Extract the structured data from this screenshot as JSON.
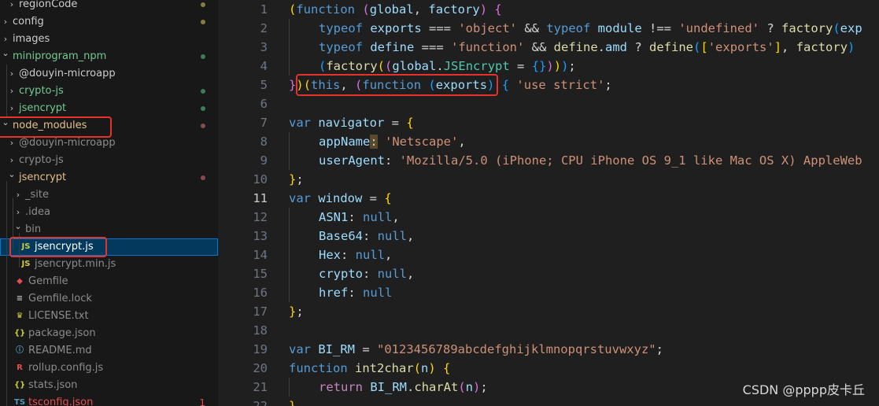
{
  "explorer": {
    "items": [
      {
        "label": "regionCode",
        "indent": 1,
        "type": "folder-closed",
        "color": "#cccccc",
        "status": "dot",
        "status_color": "#8a7a45"
      },
      {
        "label": "config",
        "indent": 0,
        "type": "folder-closed",
        "color": "#cccccc",
        "status": "dot",
        "status_color": "#8a7a45"
      },
      {
        "label": "images",
        "indent": 0,
        "type": "folder-closed",
        "color": "#cccccc"
      },
      {
        "label": "miniprogram_npm",
        "indent": 0,
        "type": "folder-open",
        "color": "#73c991",
        "status": "dot",
        "status_color": "#3f7d57"
      },
      {
        "label": "@douyin-microapp",
        "indent": 1,
        "type": "folder-closed",
        "color": "#cccccc"
      },
      {
        "label": "crypto-js",
        "indent": 1,
        "type": "folder-closed",
        "color": "#73c991",
        "status": "dot",
        "status_color": "#3f7d57"
      },
      {
        "label": "jsencrypt",
        "indent": 1,
        "type": "folder-closed",
        "color": "#73c991",
        "status": "dot",
        "status_color": "#3f7d57"
      },
      {
        "label": "node_modules",
        "indent": 0,
        "type": "folder-open",
        "color": "#e2c08d",
        "status": "dot",
        "status_color": "#8a4a4a"
      },
      {
        "label": "@douyin-microapp",
        "indent": 1,
        "type": "folder-closed",
        "color": "#8c8c8c"
      },
      {
        "label": "crypto-js",
        "indent": 1,
        "type": "folder-closed",
        "color": "#8c8c8c"
      },
      {
        "label": "jsencrypt",
        "indent": 1,
        "type": "folder-open",
        "color": "#e2c08d",
        "status": "dot",
        "status_color": "#8a4a4a"
      },
      {
        "label": "_site",
        "indent": 2,
        "type": "folder-closed",
        "color": "#8c8c8c"
      },
      {
        "label": ".idea",
        "indent": 2,
        "type": "folder-closed",
        "color": "#8c8c8c"
      },
      {
        "label": "bin",
        "indent": 2,
        "type": "folder-open",
        "color": "#8c8c8c"
      },
      {
        "label": "jsencrypt.js",
        "indent": 3,
        "type": "file",
        "icon": "JS",
        "icon_color": "#cbcb41",
        "color": "#ffffff",
        "selected": true
      },
      {
        "label": "jsencrypt.min.js",
        "indent": 3,
        "type": "file",
        "icon": "JS",
        "icon_color": "#cbcb41",
        "color": "#8c8c8c"
      },
      {
        "label": "Gemfile",
        "indent": 2,
        "type": "file",
        "icon": "◆",
        "icon_color": "#e44d4d",
        "color": "#8c8c8c"
      },
      {
        "label": "Gemfile.lock",
        "indent": 2,
        "type": "file",
        "icon": "≡",
        "icon_color": "#bbbbbb",
        "color": "#8c8c8c"
      },
      {
        "label": "LICENSE.txt",
        "indent": 2,
        "type": "file",
        "icon": "♛",
        "icon_color": "#cbcb41",
        "color": "#8c8c8c"
      },
      {
        "label": "package.json",
        "indent": 2,
        "type": "file",
        "icon": "{}",
        "icon_color": "#cbcb41",
        "color": "#8c8c8c"
      },
      {
        "label": "README.md",
        "indent": 2,
        "type": "file",
        "icon": "ⓘ",
        "icon_color": "#519aba",
        "color": "#8c8c8c"
      },
      {
        "label": "rollup.config.js",
        "indent": 2,
        "type": "file",
        "icon": "R",
        "icon_color": "#e44d4d",
        "color": "#8c8c8c"
      },
      {
        "label": "stats.json",
        "indent": 2,
        "type": "file",
        "icon": "{}",
        "icon_color": "#cbcb41",
        "color": "#8c8c8c"
      },
      {
        "label": "tsconfig.json",
        "indent": 2,
        "type": "file",
        "icon": "TS",
        "icon_color": "#519aba",
        "color": "#e44d4d",
        "status": "badge",
        "badge": "1"
      }
    ]
  },
  "editor": {
    "active_line": 11,
    "lines": [
      {
        "n": 1,
        "indent": 0,
        "tokens": [
          [
            "b1",
            "("
          ],
          [
            "kw",
            "function"
          ],
          [
            "op",
            " "
          ],
          [
            "b2",
            "("
          ],
          [
            "var",
            "global"
          ],
          [
            "op",
            ", "
          ],
          [
            "var",
            "factory"
          ],
          [
            "b2",
            ")"
          ],
          [
            "op",
            " "
          ],
          [
            "b2",
            "{"
          ]
        ]
      },
      {
        "n": 2,
        "indent": 1,
        "tokens": [
          [
            "kw",
            "typeof"
          ],
          [
            "op",
            " "
          ],
          [
            "var",
            "exports"
          ],
          [
            "op",
            " === "
          ],
          [
            "str",
            "'object'"
          ],
          [
            "op",
            " && "
          ],
          [
            "kw",
            "typeof"
          ],
          [
            "op",
            " "
          ],
          [
            "var",
            "module"
          ],
          [
            "op",
            " !== "
          ],
          [
            "str",
            "'undefined'"
          ],
          [
            "op",
            " ? "
          ],
          [
            "fn",
            "factory"
          ],
          [
            "b3",
            "("
          ],
          [
            "var",
            "exp"
          ]
        ]
      },
      {
        "n": 3,
        "indent": 1,
        "tokens": [
          [
            "kw",
            "typeof"
          ],
          [
            "op",
            " "
          ],
          [
            "var",
            "define"
          ],
          [
            "op",
            " === "
          ],
          [
            "str",
            "'function'"
          ],
          [
            "op",
            " && "
          ],
          [
            "fn",
            "define"
          ],
          [
            "op",
            "."
          ],
          [
            "var",
            "amd"
          ],
          [
            "op",
            " ? "
          ],
          [
            "fn",
            "define"
          ],
          [
            "b3",
            "("
          ],
          [
            "b1",
            "["
          ],
          [
            "str",
            "'exports'"
          ],
          [
            "b1",
            "]"
          ],
          [
            "op",
            ", "
          ],
          [
            "fn",
            "factory"
          ],
          [
            "b3",
            ")"
          ]
        ]
      },
      {
        "n": 4,
        "indent": 1,
        "tokens": [
          [
            "b3",
            "("
          ],
          [
            "fn",
            "factory"
          ],
          [
            "b1",
            "("
          ],
          [
            "b2",
            "("
          ],
          [
            "var",
            "global"
          ],
          [
            "op",
            "."
          ],
          [
            "cls",
            "JSEncrypt"
          ],
          [
            "op",
            " = "
          ],
          [
            "b3",
            "{}"
          ],
          [
            "b2",
            ")"
          ],
          [
            "b1",
            ")"
          ],
          [
            "b3",
            ")"
          ],
          [
            "op",
            ";"
          ]
        ]
      },
      {
        "n": 5,
        "indent": 0,
        "tokens": [
          [
            "b2",
            "}"
          ],
          [
            "b1",
            ")"
          ],
          [
            "b1",
            "("
          ],
          [
            "kw",
            "this"
          ],
          [
            "op",
            ", "
          ],
          [
            "b2",
            "("
          ],
          [
            "kw",
            "function"
          ],
          [
            "op",
            " "
          ],
          [
            "b3",
            "("
          ],
          [
            "var",
            "exports"
          ],
          [
            "b3",
            ")"
          ],
          [
            "op",
            " "
          ],
          [
            "b3",
            "{"
          ],
          [
            "op",
            " "
          ],
          [
            "str",
            "'use strict'"
          ],
          [
            "op",
            ";"
          ]
        ]
      },
      {
        "n": 6,
        "indent": 0,
        "tokens": []
      },
      {
        "n": 7,
        "indent": 0,
        "tokens": [
          [
            "kw",
            "var"
          ],
          [
            "op",
            " "
          ],
          [
            "var",
            "navigator"
          ],
          [
            "op",
            " = "
          ],
          [
            "b1",
            "{"
          ]
        ]
      },
      {
        "n": 8,
        "indent": 1,
        "tokens": [
          [
            "var",
            "appName"
          ],
          [
            "hlword",
            ":"
          ],
          [
            "op",
            " "
          ],
          [
            "str",
            "'Netscape'"
          ],
          [
            "op",
            ","
          ]
        ]
      },
      {
        "n": 9,
        "indent": 1,
        "tokens": [
          [
            "var",
            "userAgent"
          ],
          [
            "op",
            ": "
          ],
          [
            "str",
            "'Mozilla/5.0 (iPhone; CPU iPhone OS 9_1 like Mac OS X) AppleWeb"
          ]
        ]
      },
      {
        "n": 10,
        "indent": 0,
        "tokens": [
          [
            "b1",
            "}"
          ],
          [
            "op",
            ";"
          ]
        ]
      },
      {
        "n": 11,
        "indent": 0,
        "tokens": [
          [
            "kw",
            "var"
          ],
          [
            "op",
            " "
          ],
          [
            "var",
            "window"
          ],
          [
            "op",
            " = "
          ],
          [
            "b1",
            "{"
          ]
        ]
      },
      {
        "n": 12,
        "indent": 1,
        "tokens": [
          [
            "var",
            "ASN1"
          ],
          [
            "op",
            ": "
          ],
          [
            "kw",
            "null"
          ],
          [
            "op",
            ","
          ]
        ]
      },
      {
        "n": 13,
        "indent": 1,
        "tokens": [
          [
            "var",
            "Base64"
          ],
          [
            "op",
            ": "
          ],
          [
            "kw",
            "null"
          ],
          [
            "op",
            ","
          ]
        ]
      },
      {
        "n": 14,
        "indent": 1,
        "tokens": [
          [
            "var",
            "Hex"
          ],
          [
            "op",
            ": "
          ],
          [
            "kw",
            "null"
          ],
          [
            "op",
            ","
          ]
        ]
      },
      {
        "n": 15,
        "indent": 1,
        "tokens": [
          [
            "var",
            "crypto"
          ],
          [
            "op",
            ": "
          ],
          [
            "kw",
            "null"
          ],
          [
            "op",
            ","
          ]
        ]
      },
      {
        "n": 16,
        "indent": 1,
        "tokens": [
          [
            "var",
            "href"
          ],
          [
            "op",
            ": "
          ],
          [
            "kw",
            "null"
          ]
        ]
      },
      {
        "n": 17,
        "indent": 0,
        "tokens": [
          [
            "b1",
            "}"
          ],
          [
            "op",
            ";"
          ]
        ]
      },
      {
        "n": 18,
        "indent": 0,
        "tokens": []
      },
      {
        "n": 19,
        "indent": 0,
        "tokens": [
          [
            "kw",
            "var"
          ],
          [
            "op",
            " "
          ],
          [
            "var",
            "BI_RM"
          ],
          [
            "op",
            " = "
          ],
          [
            "str",
            "\"0123456789abcdefghijklmnopqrstuvwxyz\""
          ],
          [
            "op",
            ";"
          ]
        ]
      },
      {
        "n": 20,
        "indent": 0,
        "tokens": [
          [
            "kw",
            "function"
          ],
          [
            "op",
            " "
          ],
          [
            "fn",
            "int2char"
          ],
          [
            "b1",
            "("
          ],
          [
            "var",
            "n"
          ],
          [
            "b1",
            ")"
          ],
          [
            "op",
            " "
          ],
          [
            "b1",
            "{"
          ]
        ]
      },
      {
        "n": 21,
        "indent": 1,
        "tokens": [
          [
            "ctl",
            "return"
          ],
          [
            "op",
            " "
          ],
          [
            "var",
            "BI_RM"
          ],
          [
            "op",
            "."
          ],
          [
            "fn",
            "charAt"
          ],
          [
            "b2",
            "("
          ],
          [
            "var",
            "n"
          ],
          [
            "b2",
            ")"
          ],
          [
            "op",
            ";"
          ]
        ]
      },
      {
        "n": 22,
        "indent": 0,
        "tokens": [
          [
            "b1",
            "}"
          ]
        ]
      }
    ]
  },
  "watermark": "CSDN @pppp皮卡丘"
}
